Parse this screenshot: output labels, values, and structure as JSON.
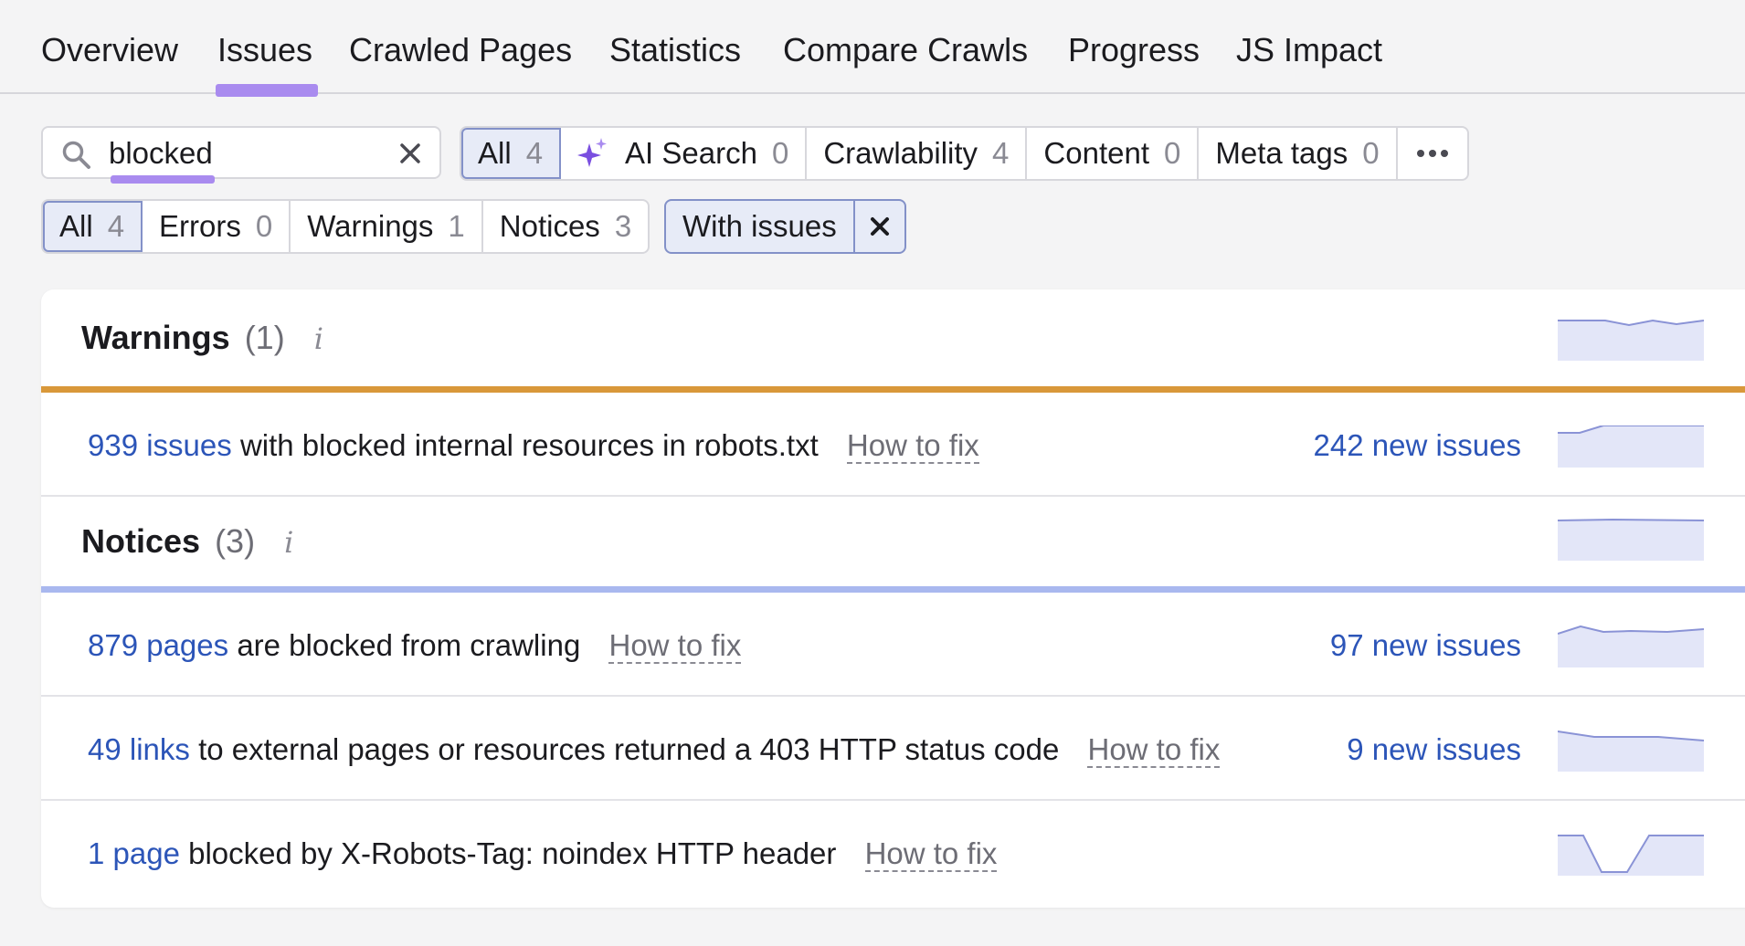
{
  "tabs": [
    {
      "label": "Overview"
    },
    {
      "label": "Issues"
    },
    {
      "label": "Crawled Pages"
    },
    {
      "label": "Statistics"
    },
    {
      "label": "Compare Crawls"
    },
    {
      "label": "Progress"
    },
    {
      "label": "JS Impact"
    }
  ],
  "search": {
    "value": "blocked"
  },
  "categories": [
    {
      "label": "All",
      "count": "4"
    },
    {
      "label": "AI Search",
      "count": "0"
    },
    {
      "label": "Crawlability",
      "count": "4"
    },
    {
      "label": "Content",
      "count": "0"
    },
    {
      "label": "Meta tags",
      "count": "0"
    }
  ],
  "severity": [
    {
      "label": "All",
      "count": "4"
    },
    {
      "label": "Errors",
      "count": "0"
    },
    {
      "label": "Warnings",
      "count": "1"
    },
    {
      "label": "Notices",
      "count": "3"
    }
  ],
  "filter_chip": {
    "label": "With issues"
  },
  "warnings": {
    "title": "Warnings",
    "count": "(1)",
    "info": "i",
    "color": "#d9983a",
    "rows": [
      {
        "link": "939 issues",
        "text": "with blocked internal resources in robots.txt",
        "fix": "How to fix",
        "new": "242 new issues"
      }
    ]
  },
  "notices": {
    "title": "Notices",
    "count": "(3)",
    "info": "i",
    "color": "#a9b8ef",
    "rows": [
      {
        "link": "879 pages",
        "text": "are blocked from crawling",
        "fix": "How to fix",
        "new": "97 new issues"
      },
      {
        "link": "49 links",
        "text": "to external pages or resources returned a 403 HTTP status code",
        "fix": "How to fix",
        "new": "9 new issues"
      },
      {
        "link": "1 page",
        "text": "blocked by X-Robots-Tag: noindex HTTP header",
        "fix": "How to fix",
        "new": ""
      }
    ]
  },
  "colors": {
    "accent": "#a98bef",
    "link": "#2c55b8",
    "spark_fill": "#e3e6f8",
    "spark_line": "#8a93d6"
  }
}
